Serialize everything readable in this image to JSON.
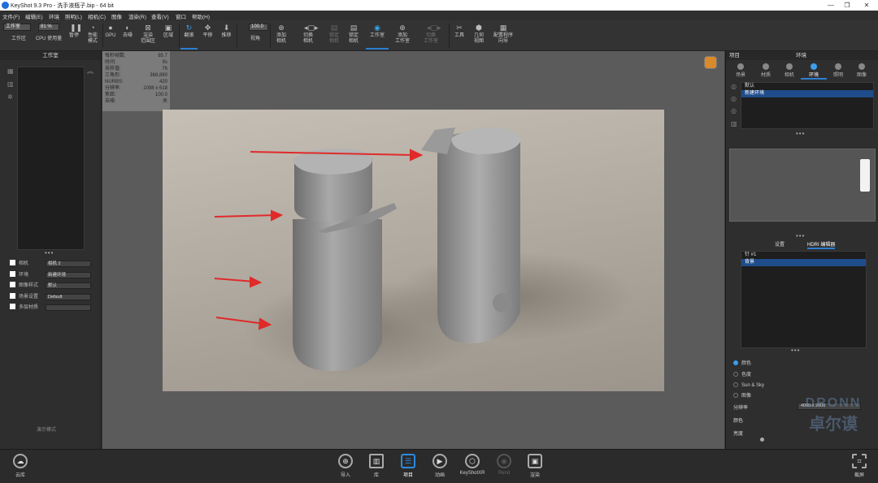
{
  "titlebar": {
    "title": "KeyShot 9.3 Pro  - 洗手液瓶子.bip  - 64 bit",
    "minimize": "—",
    "maximize": "❐",
    "close": "✕"
  },
  "menu": [
    "文件(F)",
    "编辑(E)",
    "环境",
    "照明(L)",
    "相机(C)",
    "图像",
    "渲染(R)",
    "查看(V)",
    "窗口",
    "帮助(H)"
  ],
  "toolbar": {
    "workspace_select": "工作室",
    "workspace_label": "工作区",
    "cpu_value": "81 %",
    "cpu_label": "CPU 使用量",
    "pause": "暂停",
    "perf": "性能\n模式",
    "gpu": "GPU",
    "denoise": "去噪",
    "render_region": "渲染\n范围区",
    "region": "区域",
    "tumble": "翻滚",
    "pan": "平移",
    "dolly": "推移",
    "fov_value": "100.0",
    "fov": "视角",
    "add_camera": "添加\n相机",
    "switch_camera": "切换\n相机",
    "lock_camera": "锁定\n相机",
    "lock_camera2": "锁定\n相机",
    "studio": "工作室",
    "add_studio": "添加\n工作室",
    "switch_studio": "切换\n工作室",
    "tools": "工具",
    "geometry": "几何\n视图",
    "config": "配置程序\n向导"
  },
  "left_panel": {
    "title": "工作室",
    "rows": [
      {
        "label": "相机",
        "value": "相机 2"
      },
      {
        "label": "环境",
        "value": "新建环境"
      },
      {
        "label": "图像样式",
        "value": "默认"
      },
      {
        "label": "场景设置",
        "value": "Default"
      },
      {
        "label": "多层材质",
        "value": ""
      }
    ],
    "footer": "演示模式"
  },
  "stats": [
    {
      "k": "每秒帧数:",
      "v": "85.7"
    },
    {
      "k": "时间:",
      "v": "9s"
    },
    {
      "k": "采样值:",
      "v": "76"
    },
    {
      "k": "三角形:",
      "v": "368,890"
    },
    {
      "k": "NURBS:",
      "v": "420"
    },
    {
      "k": "分辨率:",
      "v": "1098 x 618"
    },
    {
      "k": "焦距:",
      "v": "100.0"
    },
    {
      "k": "去噪:",
      "v": "关"
    }
  ],
  "right_panel": {
    "title_left": "项目",
    "title_center": "环境",
    "tabs": [
      "场景",
      "材质",
      "相机",
      "环境",
      "照明",
      "图像"
    ],
    "active_tab": 3,
    "env_list": [
      "默认",
      "新建环境"
    ],
    "subtabs": [
      "设置",
      "HDRI 编辑器"
    ],
    "hdri_list": [
      "针 #1",
      "背景"
    ],
    "bg_options": [
      "颜色",
      "色度",
      "Sun & Sky",
      "图像"
    ],
    "resolution_label": "分辨率",
    "resolution_value": "4000 x 2000",
    "color_label": "颜色",
    "brightness_label": "亮度"
  },
  "bottom": {
    "cloud": "云库",
    "import": "导入",
    "library": "库",
    "project": "项目",
    "animation": "动画",
    "xr": "KeyShotXR",
    "render_dim": "Rend",
    "render": "渲染",
    "screenshot": "截屏"
  },
  "watermark": {
    "line1": "DRONN",
    "line2": "卓尔谟"
  },
  "colors": {
    "accent": "#2c7fd0",
    "arrow": "#e02a2a"
  }
}
